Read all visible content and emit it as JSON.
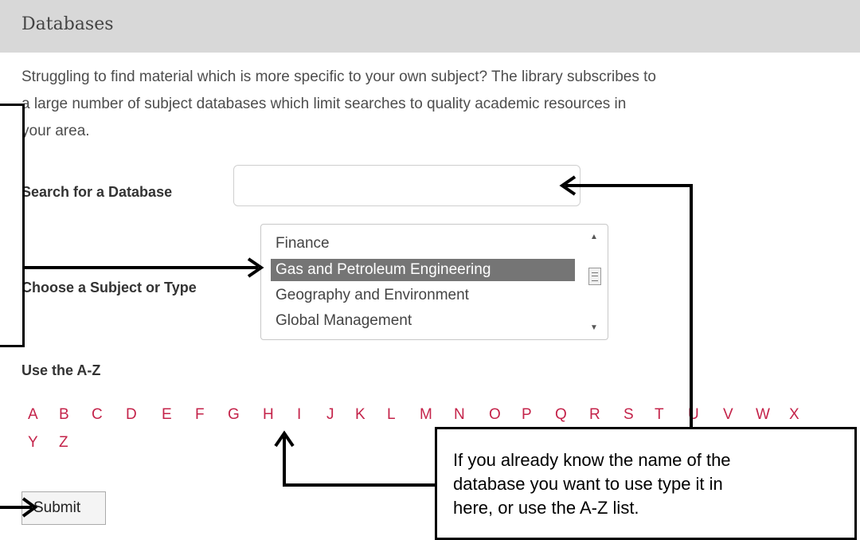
{
  "header": {
    "title": "Databases"
  },
  "intro": {
    "lines": [
      "Struggling to find material which is more specific to your own subject? The library subscribes to",
      "a large number of subject databases which limit searches to quality academic resources in",
      "your area."
    ]
  },
  "search": {
    "label": "Search for a Database",
    "value": "",
    "placeholder": ""
  },
  "subject": {
    "label": "Choose a Subject or Type",
    "options": [
      "Finance",
      "Gas and Petroleum Engineering",
      "Geography and Environment",
      "Global Management"
    ],
    "selected": "Gas and Petroleum Engineering"
  },
  "az": {
    "label": "Use the A-Z",
    "letters": [
      "A",
      "B",
      "C",
      "D",
      "E",
      "F",
      "G",
      "H",
      "I",
      "J",
      "K",
      "L",
      "M",
      "N",
      "O",
      "P",
      "Q",
      "R",
      "S",
      "T",
      "U",
      "V",
      "W",
      "X",
      "Y",
      "Z"
    ]
  },
  "submit": {
    "label": "Submit"
  },
  "callout": {
    "lines": [
      "If you already know the name of the",
      "database you want to use type it in",
      "here, or use the A-Z list."
    ]
  },
  "colors": {
    "letter_link": "#c4234a",
    "header_bg": "#d8d8d8",
    "selected_option_bg": "#757575"
  },
  "icons": [
    "scroll-up-icon",
    "scroll-down-icon",
    "scroll-thumb-icon",
    "arrow-icon"
  ]
}
